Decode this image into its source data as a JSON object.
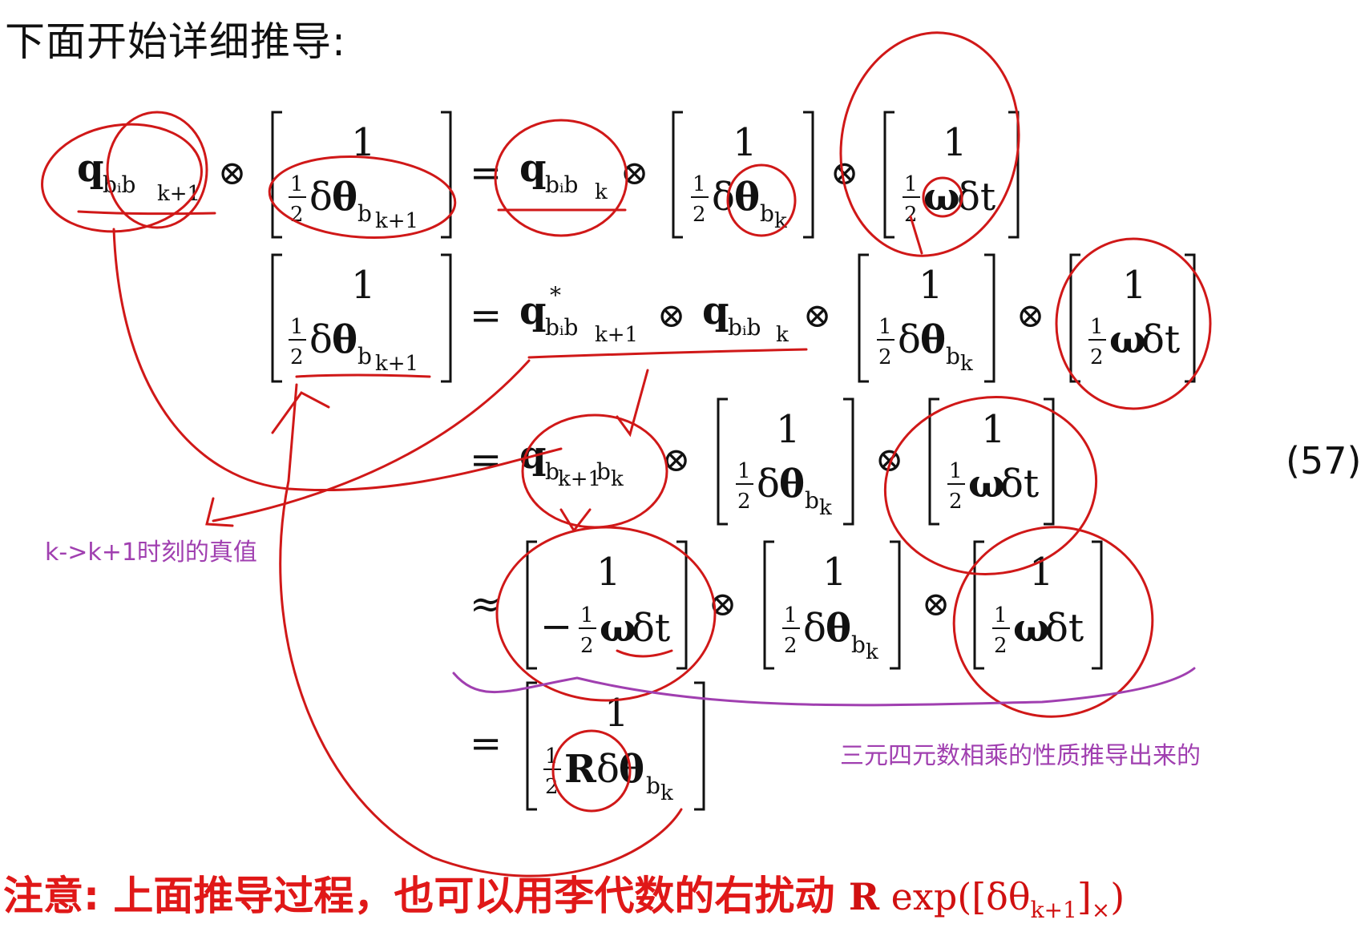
{
  "heading": "下面开始详细推导:",
  "equation_number": "(57)",
  "annotations": {
    "true_value_note": "k->k+1时刻的真值",
    "triple_quaternion_note": "三元四元数相乘的性质推导出来的"
  },
  "note": {
    "label": "注意: 上面推导过程，也可以用李代数的右扰动 ",
    "formula_R": "R",
    "formula_rest": " exp([δθ",
    "formula_sub": "k+1",
    "formula_end": "]",
    "formula_x": "×",
    "formula_close": ")"
  },
  "math": {
    "q": "q",
    "otimes": "⊗",
    "eq": "=",
    "approx": "≈",
    "one": "1",
    "half_num": "1",
    "half_den": "2",
    "neg": "−",
    "delta": "δ",
    "theta": "θ",
    "omega": "ω",
    "dt": "δt",
    "R": "R",
    "star": "*",
    "sub_bi_bk1": "bᵢb",
    "sub_k1": "k+1",
    "sub_k": "k",
    "sub_bk1_bk": "b",
    "sub_b": "b"
  },
  "colors": {
    "ink_red": "#d01818",
    "ink_purple": "#a03fb0",
    "note_red": "#e01818"
  }
}
